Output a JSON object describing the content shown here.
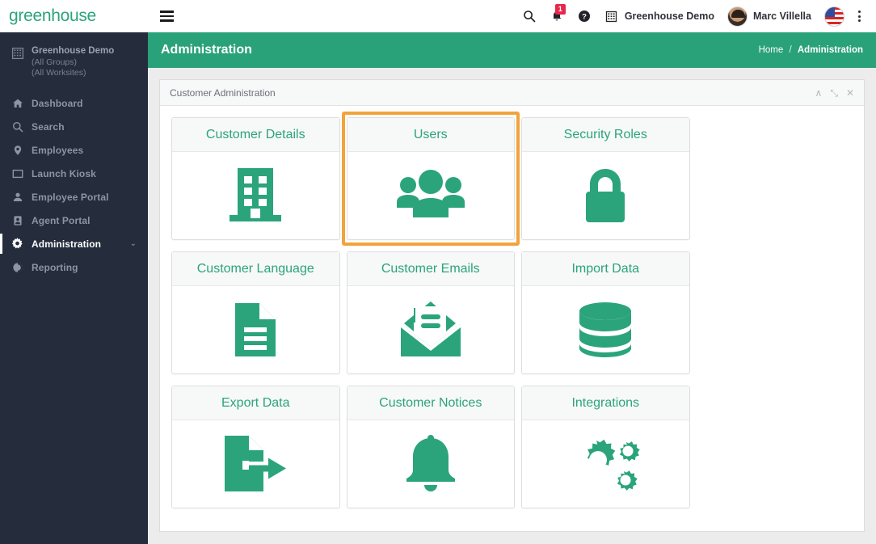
{
  "brand": {
    "logo_text": "greenhouse",
    "green": "#2BA47C",
    "sidebar_bg": "#252D3D",
    "highlight_orange": "#F2A33C"
  },
  "topbar": {
    "hamburger_label": "menu-toggle",
    "search_icon": "search-icon",
    "notifications_icon": "bell-icon",
    "notifications_count": "1",
    "help_icon": "help-circle-icon",
    "company_icon": "building-icon",
    "company_label": "Greenhouse Demo",
    "user_name": "Marc Villella",
    "flag_icon": "us-flag-icon",
    "overflow_icon": "kebab-menu-icon"
  },
  "sidebar": {
    "company": {
      "name": "Greenhouse Demo",
      "group": "(All Groups)",
      "worksite": "(All Worksites)"
    },
    "items": [
      {
        "label": "Dashboard",
        "icon": "home-icon",
        "active": false
      },
      {
        "label": "Search",
        "icon": "search-icon",
        "active": false
      },
      {
        "label": "Employees",
        "icon": "map-pin-icon",
        "active": false
      },
      {
        "label": "Launch Kiosk",
        "icon": "kiosk-icon",
        "active": false
      },
      {
        "label": "Employee Portal",
        "icon": "person-icon",
        "active": false
      },
      {
        "label": "Agent Portal",
        "icon": "id-badge-icon",
        "active": false
      },
      {
        "label": "Administration",
        "icon": "gear-icon",
        "active": true,
        "chevron": "⌄"
      },
      {
        "label": "Reporting",
        "icon": "pie-chart-icon",
        "active": false
      }
    ]
  },
  "page": {
    "title": "Administration",
    "breadcrumb": {
      "home": "Home",
      "separator": "/",
      "current": "Administration"
    }
  },
  "panel": {
    "title": "Customer Administration",
    "controls": [
      {
        "name": "collapse-icon",
        "glyph": "∧"
      },
      {
        "name": "expand-icon",
        "glyph": "⤡"
      },
      {
        "name": "close-icon",
        "glyph": "✕"
      }
    ]
  },
  "tiles": [
    {
      "label": "Customer Details",
      "icon": "building-icon",
      "selected": false
    },
    {
      "label": "Users",
      "icon": "users-group-icon",
      "selected": true
    },
    {
      "label": "Security Roles",
      "icon": "padlock-icon",
      "selected": false
    },
    {
      "label": "Customer Language",
      "icon": "document-lines-icon",
      "selected": false
    },
    {
      "label": "Customer Emails",
      "icon": "open-envelope-icon",
      "selected": false
    },
    {
      "label": "Import Data",
      "icon": "database-icon",
      "selected": false
    },
    {
      "label": "Export Data",
      "icon": "document-export-icon",
      "selected": false
    },
    {
      "label": "Customer Notices",
      "icon": "bell-icon",
      "selected": false
    },
    {
      "label": "Integrations",
      "icon": "gears-icon",
      "selected": false
    }
  ]
}
